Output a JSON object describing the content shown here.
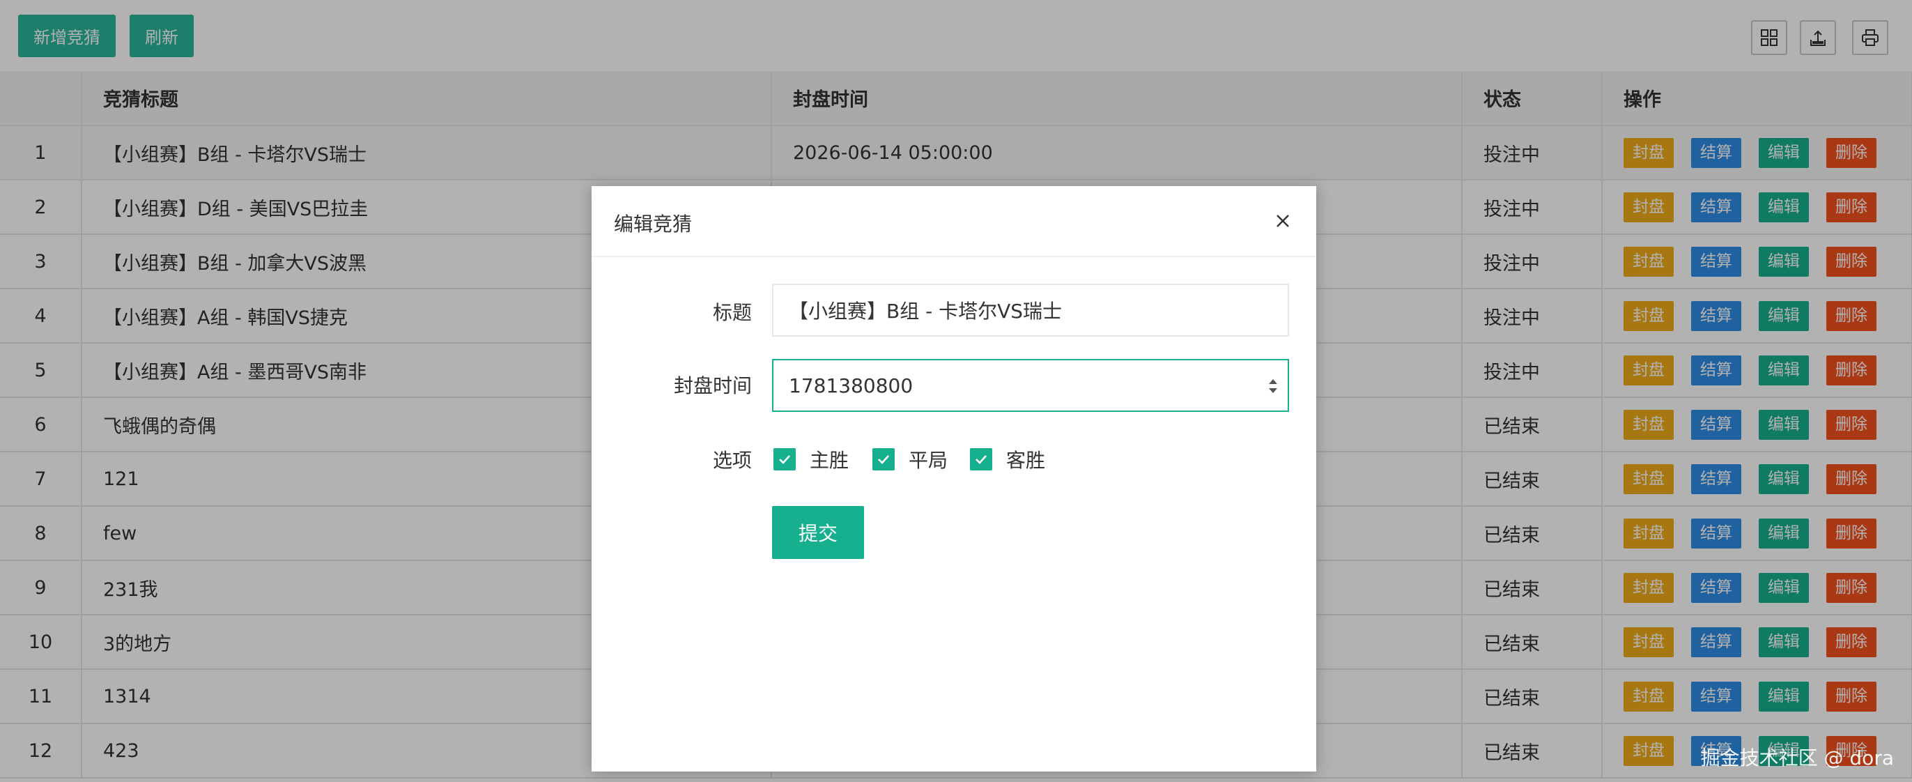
{
  "toolbar": {
    "add_label": "新增竞猜",
    "refresh_label": "刷新",
    "icons": [
      "columns-icon",
      "export-icon",
      "print-icon"
    ]
  },
  "table": {
    "headers": [
      "",
      "竞猜标题",
      "封盘时间",
      "状态",
      "操作"
    ],
    "row_actions": [
      "封盘",
      "结算",
      "编辑",
      "删除"
    ],
    "rows": [
      {
        "idx": "1",
        "title": "【小组赛】B组 - 卡塔尔VS瑞士",
        "time": "2026-06-14 05:00:00",
        "status": "投注中"
      },
      {
        "idx": "2",
        "title": "【小组赛】D组 - 美国VS巴拉圭",
        "time": "",
        "status": "投注中"
      },
      {
        "idx": "3",
        "title": "【小组赛】B组 - 加拿大VS波黑",
        "time": "",
        "status": "投注中"
      },
      {
        "idx": "4",
        "title": "【小组赛】A组 - 韩国VS捷克",
        "time": "",
        "status": "投注中"
      },
      {
        "idx": "5",
        "title": "【小组赛】A组 - 墨西哥VS南非",
        "time": "",
        "status": "投注中"
      },
      {
        "idx": "6",
        "title": "飞蛾偶的奇偶",
        "time": "",
        "status": "已结束"
      },
      {
        "idx": "7",
        "title": "121",
        "time": "",
        "status": "已结束"
      },
      {
        "idx": "8",
        "title": "few",
        "time": "",
        "status": "已结束"
      },
      {
        "idx": "9",
        "title": "231我",
        "time": "",
        "status": "已结束"
      },
      {
        "idx": "10",
        "title": "3的地方",
        "time": "",
        "status": "已结束"
      },
      {
        "idx": "11",
        "title": "1314",
        "time": "",
        "status": "已结束"
      },
      {
        "idx": "12",
        "title": "423",
        "time": "",
        "status": "已结束"
      }
    ]
  },
  "dialog": {
    "title": "编辑竞猜",
    "title_label": "标题",
    "title_value": "【小组赛】B组 - 卡塔尔VS瑞士",
    "time_label": "封盘时间",
    "time_value": "1781380800",
    "options_label": "选项",
    "options": [
      "主胜",
      "平局",
      "客胜"
    ],
    "submit_label": "提交"
  },
  "watermark": "掘金技术社区 @ dora",
  "colors": {
    "primary": "#16b08e",
    "seal": "#f0ad1a",
    "settle": "#2f8de4",
    "delete": "#f4511e",
    "active_status": "#1e9b3e"
  }
}
